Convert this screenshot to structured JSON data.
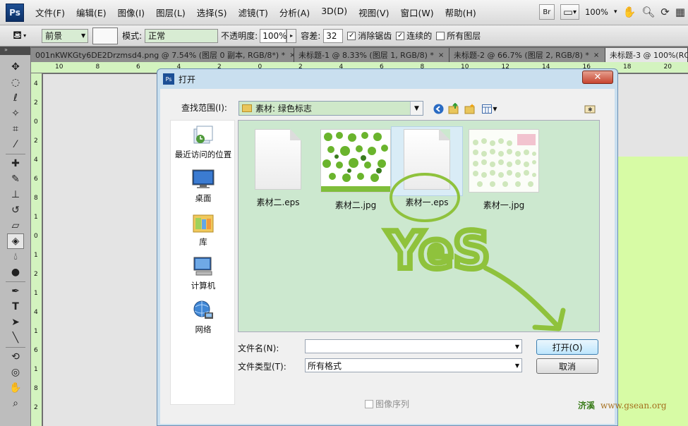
{
  "app": {
    "logo": "Ps",
    "menus": [
      "文件(F)",
      "编辑(E)",
      "图像(I)",
      "图层(L)",
      "选择(S)",
      "滤镜(T)",
      "分析(A)",
      "3D(D)",
      "视图(V)",
      "窗口(W)",
      "帮助(H)"
    ],
    "bridge_label": "Br",
    "zoom": "100%"
  },
  "options": {
    "fill_source": "前景",
    "mode_label": "模式:",
    "mode_value": "正常",
    "opacity_label": "不透明度:",
    "opacity_value": "100%",
    "tolerance_label": "容差:",
    "tolerance_value": "32",
    "antialias_label": "消除锯齿",
    "antialias_checked": true,
    "contiguous_label": "连续的",
    "contiguous_checked": true,
    "all_layers_label": "所有图层",
    "all_layers_checked": false
  },
  "tabs": [
    {
      "label": "001nKWKGty6DE2Drzmsd4.png @ 7.54% (图层 0 副本, RGB/8*) *",
      "active": false
    },
    {
      "label": "未标题-1 @ 8.33% (图层 1, RGB/8) *",
      "active": false
    },
    {
      "label": "未标题-2 @ 66.7% (图层 2, RGB/8) *",
      "active": false
    },
    {
      "label": "未标题-3 @ 100%(RG",
      "active": true
    }
  ],
  "ruler": {
    "top": [
      "10",
      "8",
      "6",
      "4",
      "2",
      "0",
      "2",
      "4",
      "6",
      "8",
      "10",
      "12",
      "14",
      "16",
      "18",
      "20"
    ],
    "left": [
      "4",
      "2",
      "0",
      "2",
      "4",
      "6",
      "8",
      "1",
      "0",
      "1",
      "2",
      "1",
      "4",
      "1",
      "6",
      "1",
      "8",
      "2"
    ]
  },
  "dialog": {
    "title": "打开",
    "close": "✕",
    "look_in_label": "查找范围(I):",
    "look_in_value": "素材: 绿色标志",
    "places": [
      {
        "label": "最近访问的位置",
        "icon": "recent-places-icon"
      },
      {
        "label": "桌面",
        "icon": "desktop-icon"
      },
      {
        "label": "库",
        "icon": "libraries-icon"
      },
      {
        "label": "计算机",
        "icon": "computer-icon"
      },
      {
        "label": "网络",
        "icon": "network-icon"
      }
    ],
    "files": [
      {
        "name": "素材二.eps",
        "type": "blank"
      },
      {
        "name": "素材二.jpg",
        "type": "image"
      },
      {
        "name": "素材一.eps",
        "type": "blank",
        "selected": true
      },
      {
        "name": "素材一.jpg",
        "type": "image"
      }
    ],
    "filename_label": "文件名(N):",
    "filename_value": "",
    "filetype_label": "文件类型(T):",
    "filetype_value": "所有格式",
    "open_button": "打开(O)",
    "cancel_button": "取消",
    "image_sequence_label": "图像序列",
    "annotation_text": "YeS"
  },
  "watermark": {
    "cn": "济溪",
    "url": "www.gsean.org"
  }
}
